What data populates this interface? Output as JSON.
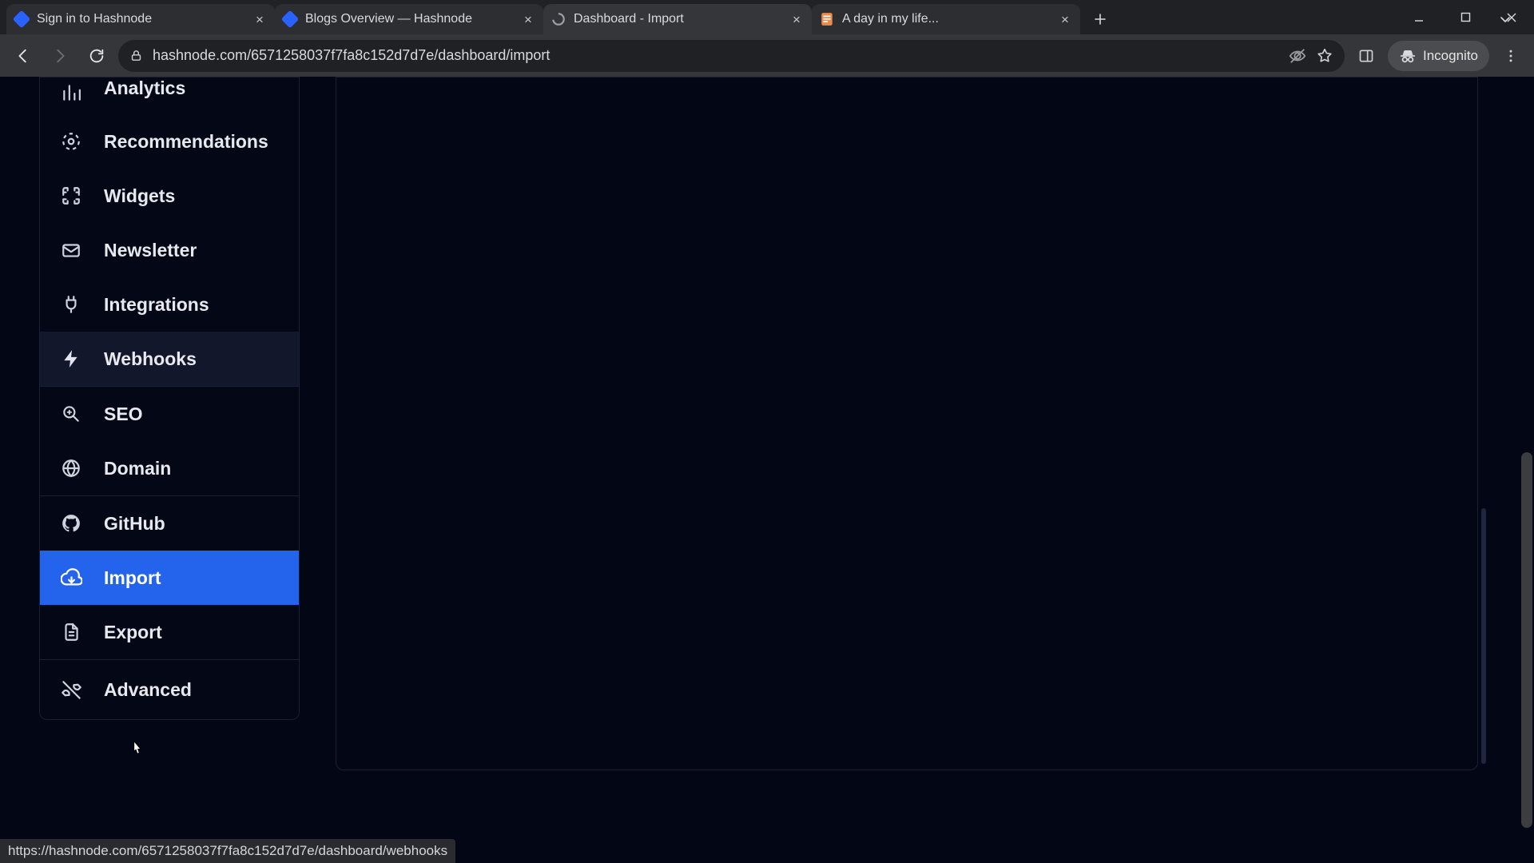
{
  "browser": {
    "tabs": [
      {
        "title": "Sign in to Hashnode",
        "favicon": "hashnode",
        "active": false
      },
      {
        "title": "Blogs Overview — Hashnode",
        "favicon": "hashnode",
        "active": false
      },
      {
        "title": "Dashboard - Import",
        "favicon": "loading",
        "active": true
      },
      {
        "title": "A day in my life...",
        "favicon": "doc",
        "active": false
      }
    ],
    "url": "hashnode.com/6571258037f7fa8c152d7d7e/dashboard/import",
    "incognito_label": "Incognito"
  },
  "sidebar": {
    "groups": [
      {
        "items": [
          {
            "label": "Analytics",
            "icon": "analytics-icon"
          },
          {
            "label": "Recommendations",
            "icon": "recommendations-icon"
          },
          {
            "label": "Widgets",
            "icon": "widgets-icon"
          },
          {
            "label": "Newsletter",
            "icon": "newsletter-icon"
          },
          {
            "label": "Integrations",
            "icon": "integrations-icon"
          },
          {
            "label": "Webhooks",
            "icon": "webhooks-icon",
            "state": "hover"
          }
        ]
      },
      {
        "items": [
          {
            "label": "SEO",
            "icon": "seo-icon"
          },
          {
            "label": "Domain",
            "icon": "domain-icon"
          }
        ]
      },
      {
        "items": [
          {
            "label": "GitHub",
            "icon": "github-icon"
          },
          {
            "label": "Import",
            "icon": "import-icon",
            "state": "selected"
          },
          {
            "label": "Export",
            "icon": "export-icon"
          }
        ]
      },
      {
        "items": [
          {
            "label": "Advanced",
            "icon": "advanced-icon"
          }
        ]
      }
    ]
  },
  "status_bar": {
    "text": "https://hashnode.com/6571258037f7fa8c152d7d7e/dashboard/webhooks"
  }
}
